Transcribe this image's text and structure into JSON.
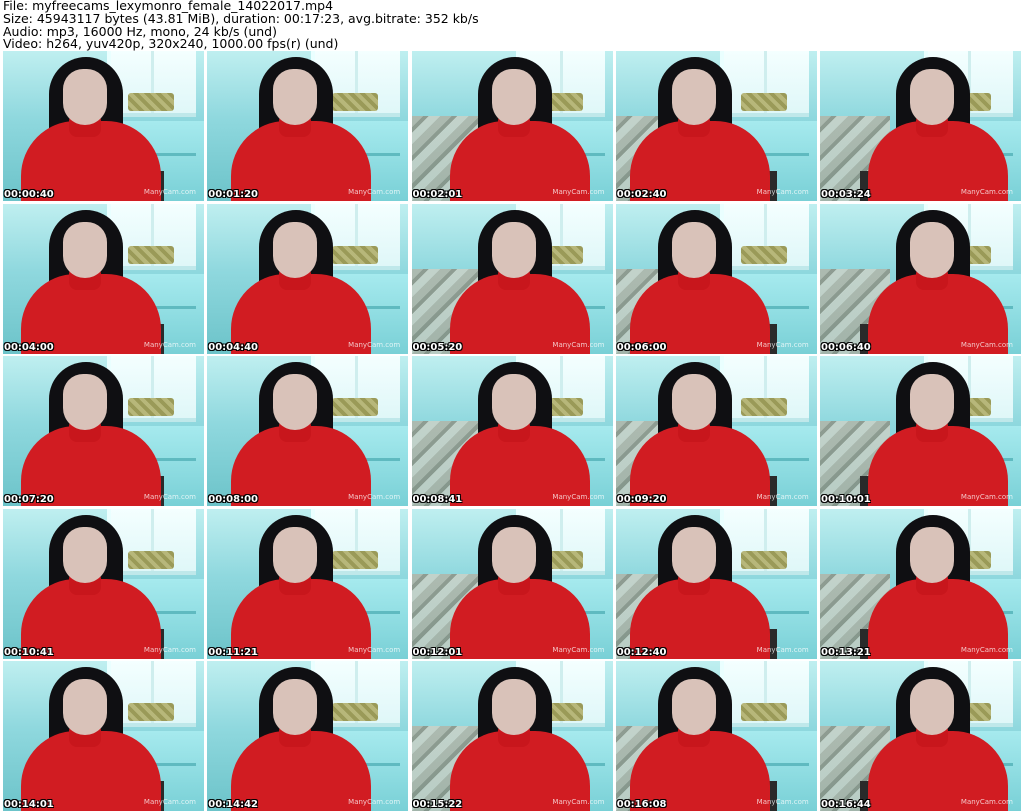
{
  "header": {
    "file": "File: myfreecams_lexymonro_female_14022017.mp4",
    "size": "Size: 45943117 bytes (43.81 MiB), duration: 00:17:23, avg.bitrate: 352 kb/s",
    "audio": "Audio: mp3, 16000 Hz, mono, 24 kb/s (und)",
    "video": "Video: h264, yuv420p, 320x240, 1000.00 fps(r) (und)"
  },
  "watermark": "ManyCam.com",
  "thumbnails": [
    "00:00:40",
    "00:01:20",
    "00:02:01",
    "00:02:40",
    "00:03:24",
    "00:04:00",
    "00:04:40",
    "00:05:20",
    "00:06:00",
    "00:06:40",
    "00:07:20",
    "00:08:00",
    "00:08:41",
    "00:09:20",
    "00:10:01",
    "00:10:41",
    "00:11:21",
    "00:12:01",
    "00:12:40",
    "00:13:21",
    "00:14:01",
    "00:14:42",
    "00:15:22",
    "00:16:08",
    "00:16:44"
  ]
}
